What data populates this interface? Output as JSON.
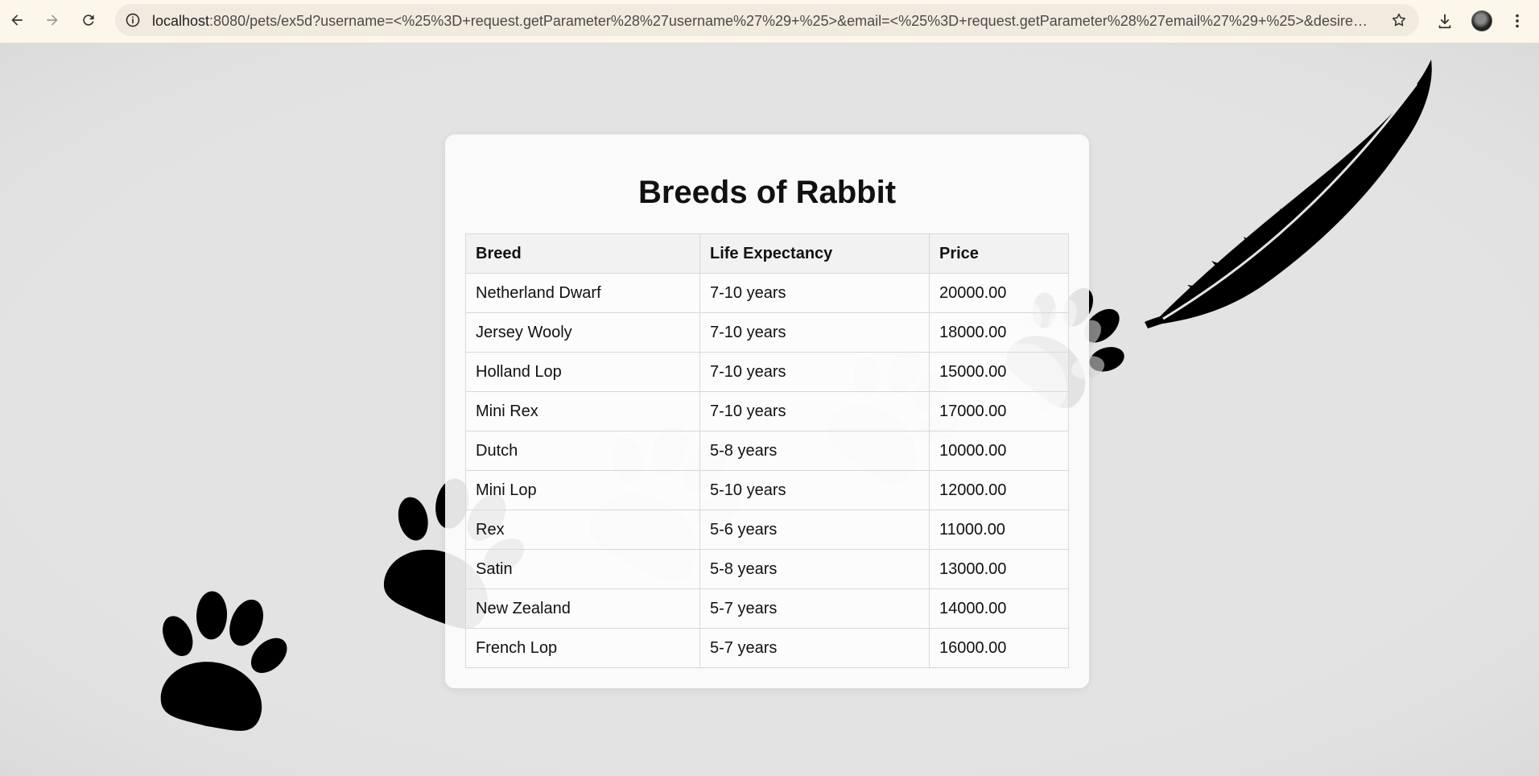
{
  "browser": {
    "url_host": "localhost",
    "url_rest": ":8080/pets/ex5d?username=<%25%3D+request.getParameter%28%27username%27%29+%25>&email=<%25%3D+request.getParameter%28%27email%27%29+%25>&desiredAnimal..."
  },
  "page": {
    "title": "Breeds of Rabbit",
    "columns": [
      "Breed",
      "Life Expectancy",
      "Price"
    ],
    "rows": [
      [
        "Netherland Dwarf",
        "7-10 years",
        "20000.00"
      ],
      [
        "Jersey Wooly",
        "7-10 years",
        "18000.00"
      ],
      [
        "Holland Lop",
        "7-10 years",
        "15000.00"
      ],
      [
        "Mini Rex",
        "7-10 years",
        "17000.00"
      ],
      [
        "Dutch",
        "5-8 years",
        "10000.00"
      ],
      [
        "Mini Lop",
        "5-10 years",
        "12000.00"
      ],
      [
        "Rex",
        "5-6 years",
        "11000.00"
      ],
      [
        "Satin",
        "5-8 years",
        "13000.00"
      ],
      [
        "New Zealand",
        "5-7 years",
        "14000.00"
      ],
      [
        "French Lop",
        "5-7 years",
        "16000.00"
      ]
    ]
  },
  "decorations": {
    "icons": [
      "paw-print-icon",
      "feather-icon"
    ],
    "colors": {
      "paw_dark": "#000000",
      "paw_light": "#d0d0d0",
      "background": "#e3e3e3"
    }
  }
}
